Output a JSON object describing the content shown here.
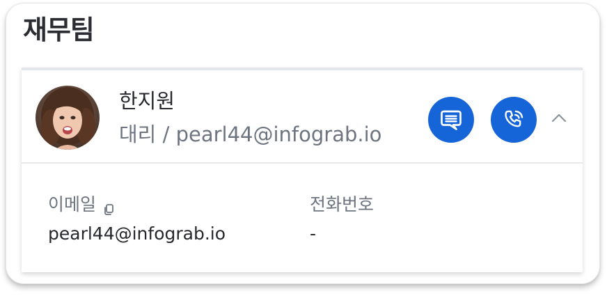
{
  "team": {
    "title": "재무팀"
  },
  "member": {
    "name": "한지원",
    "subtitle": "대리 / pearl44@infograb.io",
    "avatar_icon": "avatar-photo",
    "actions": {
      "message_icon": "chat-bubble-icon",
      "call_icon": "phone-icon",
      "collapse_icon": "chevron-up-icon"
    },
    "details": {
      "email_label": "이메일",
      "email_value": "pearl44@infograb.io",
      "phone_label": "전화번호",
      "phone_value": "-"
    }
  },
  "colors": {
    "accent": "#1565d8",
    "text_primary": "#25272c",
    "text_secondary": "#6d7480"
  }
}
